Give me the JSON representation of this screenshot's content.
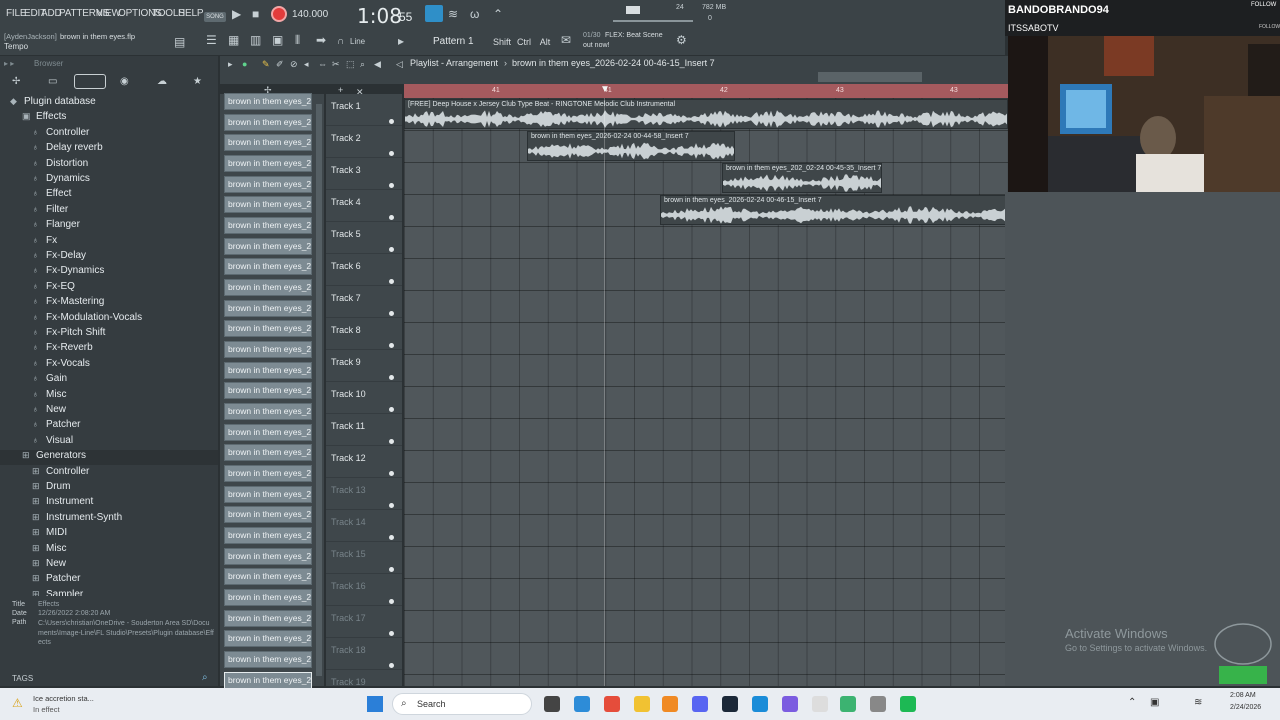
{
  "menu": {
    "items": [
      "FILE",
      "EDIT",
      "ADD",
      "PATTERNS",
      "VIEW",
      "OPTIONS",
      "TOOLS",
      "HELP"
    ],
    "song_badge": "SONG"
  },
  "transport": {
    "tempo": "140.000",
    "time": "1:08",
    "time_sub": "55",
    "counter_top": "24",
    "cpu_top": "782 MB",
    "cpu_sub": "0"
  },
  "project": {
    "user_file": "[AydenJackson]",
    "file_name": "brown in them eyes.flp",
    "tempo_label": "Tempo",
    "snap": "Line",
    "pattern": "Pattern 1",
    "shift": "Shift",
    "ctrl": "Ctrl",
    "alt": "Alt",
    "news_date": "01/30",
    "news_line1": "FLEX: Beat Scene",
    "news_line2": "out now!"
  },
  "browser": {
    "title": "Browser",
    "root": "Plugin database",
    "effects_header": "Effects",
    "effects": [
      "Controller",
      "Delay reverb",
      "Distortion",
      "Dynamics",
      "Effect",
      "Filter",
      "Flanger",
      "Fx",
      "Fx-Delay",
      "Fx-Dynamics",
      "Fx-EQ",
      "Fx-Mastering",
      "Fx-Modulation-Vocals",
      "Fx-Pitch Shift",
      "Fx-Reverb",
      "Fx-Vocals",
      "Gain",
      "Misc",
      "New",
      "Patcher",
      "Visual"
    ],
    "generators_header": "Generators",
    "generators": [
      "Controller",
      "Drum",
      "Instrument",
      "Instrument-Synth",
      "MIDI",
      "Misc",
      "New",
      "Patcher",
      "Sampler"
    ],
    "info_title_label": "Title",
    "info_title": "Effects",
    "info_date_label": "Date",
    "info_date": "12/26/2022 2:08:20 AM",
    "info_path_label": "Path",
    "info_path": "C:\\Users\\christian\\OneDrive - Souderton Area SD\\Documents\\Image-Line\\FL Studio\\Presets\\Plugin database\\Effects",
    "tags": "TAGS"
  },
  "playlist": {
    "title": "Playlist - Arrangement",
    "breadcrumb": "brown in them eyes_2026-02-24 00-46-15_Insert 7",
    "ruler": [
      "41",
      "41",
      "42",
      "43",
      "43"
    ]
  },
  "channels": {
    "label": "brown in them eyes_202...",
    "count": 29
  },
  "tracks": [
    "Track 1",
    "Track 2",
    "Track 3",
    "Track 4",
    "Track 5",
    "Track 6",
    "Track 7",
    "Track 8",
    "Track 9",
    "Track 10",
    "Track 11",
    "Track 12",
    "Track 13",
    "Track 14",
    "Track 15",
    "Track 16",
    "Track 17",
    "Track 18",
    "Track 19"
  ],
  "clips": [
    {
      "label": "[FREE] Deep House x Jersey Club Type Beat - RINGTONE  Melodic Club Instrumental",
      "track": 0
    },
    {
      "label": "brown in them eyes_2026-02-24 00-44-58_Insert 7",
      "track": 1
    },
    {
      "label": "brown in them eyes_202_02-24 00-45-35_Insert 7",
      "track": 2
    },
    {
      "label": "brown in them eyes_2026-02-24 00-46-15_Insert 7",
      "track": 3
    }
  ],
  "overlay": {
    "streamer1": "BANDOBRANDO94",
    "streamer2": "ITSSABOTV",
    "follow": "FOLLOW"
  },
  "watermark": {
    "line1": "Activate Windows",
    "line2": "Go to Settings to activate Windows."
  },
  "taskbar": {
    "search": "Search",
    "notif_title": "Ice accretion sta...",
    "notif_sub": "In effect",
    "time": "2:08 AM",
    "date": "2/24/2026"
  },
  "colors": {
    "accent": "#a55a5e",
    "record": "#e23b3b",
    "clip_bg": "#3f4649",
    "channel": "#7d8b93"
  }
}
